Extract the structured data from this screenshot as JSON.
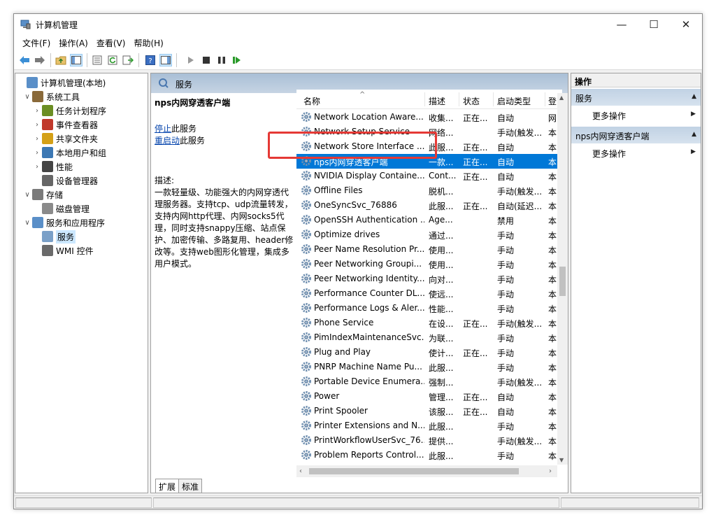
{
  "window": {
    "title": "计算机管理",
    "controls": {
      "minimize": "—",
      "maximize": "☐",
      "close": "✕"
    }
  },
  "menubar": [
    {
      "label": "文件(F)"
    },
    {
      "label": "操作(A)"
    },
    {
      "label": "查看(V)"
    },
    {
      "label": "帮助(H)"
    }
  ],
  "tree": [
    {
      "label": "计算机管理(本地)",
      "icon": "computer-management-icon",
      "level": 0,
      "expander": ""
    },
    {
      "label": "系统工具",
      "icon": "tools-icon",
      "level": 1,
      "expander": "∨"
    },
    {
      "label": "任务计划程序",
      "icon": "clock-icon",
      "level": 2,
      "expander": "›"
    },
    {
      "label": "事件查看器",
      "icon": "event-viewer-icon",
      "level": 2,
      "expander": "›"
    },
    {
      "label": "共享文件夹",
      "icon": "shared-folder-icon",
      "level": 2,
      "expander": "›"
    },
    {
      "label": "本地用户和组",
      "icon": "users-icon",
      "level": 2,
      "expander": "›"
    },
    {
      "label": "性能",
      "icon": "performance-icon",
      "level": 2,
      "expander": "›"
    },
    {
      "label": "设备管理器",
      "icon": "device-manager-icon",
      "level": 2,
      "expander": ""
    },
    {
      "label": "存储",
      "icon": "storage-icon",
      "level": 1,
      "expander": "∨"
    },
    {
      "label": "磁盘管理",
      "icon": "disk-management-icon",
      "level": 2,
      "expander": ""
    },
    {
      "label": "服务和应用程序",
      "icon": "services-apps-icon",
      "level": 1,
      "expander": "∨"
    },
    {
      "label": "服务",
      "icon": "services-icon",
      "level": 2,
      "expander": "",
      "selected": true
    },
    {
      "label": "WMI 控件",
      "icon": "wmi-icon",
      "level": 2,
      "expander": ""
    }
  ],
  "center": {
    "header": "服务",
    "service_title": "nps内网穿透客户端",
    "stop_link": "停止",
    "stop_suffix": "此服务",
    "restart_link": "重启动",
    "restart_suffix": "此服务",
    "desc_label": "描述:",
    "desc_text": "一款轻量级、功能强大的内网穿透代理服务器。支持tcp、udp流量转发，支持内网http代理、内网socks5代理，同时支持snappy压缩、站点保护、加密传输、多路复用、header修改等。支持web图形化管理，集成多用户模式。",
    "columns": {
      "name": "名称",
      "desc": "描述",
      "status": "状态",
      "startup": "启动类型",
      "login": "登"
    },
    "tabs": [
      {
        "label": "扩展",
        "active": true
      },
      {
        "label": "标准",
        "active": false
      }
    ]
  },
  "services": [
    {
      "name": "Network Location Aware...",
      "desc": "收集...",
      "status": "正在...",
      "startup": "自动",
      "login": "网"
    },
    {
      "name": "Network Setup Service",
      "desc": "网络...",
      "status": "",
      "startup": "手动(触发...",
      "login": "本"
    },
    {
      "name": "Network Store Interface ...",
      "desc": "此服...",
      "status": "正在...",
      "startup": "自动",
      "login": "本"
    },
    {
      "name": "nps内网穿透客户端",
      "desc": "一款...",
      "status": "正在...",
      "startup": "自动",
      "login": "本",
      "selected": true
    },
    {
      "name": "NVIDIA Display Containe...",
      "desc": "Cont...",
      "status": "正在...",
      "startup": "自动",
      "login": "本"
    },
    {
      "name": "Offline Files",
      "desc": "脱机...",
      "status": "",
      "startup": "手动(触发...",
      "login": "本"
    },
    {
      "name": "OneSyncSvc_76886",
      "desc": "此服...",
      "status": "正在...",
      "startup": "自动(延迟...",
      "login": "本"
    },
    {
      "name": "OpenSSH Authentication ...",
      "desc": "Age...",
      "status": "",
      "startup": "禁用",
      "login": "本"
    },
    {
      "name": "Optimize drives",
      "desc": "通过...",
      "status": "",
      "startup": "手动",
      "login": "本"
    },
    {
      "name": "Peer Name Resolution Pr...",
      "desc": "使用...",
      "status": "",
      "startup": "手动",
      "login": "本"
    },
    {
      "name": "Peer Networking Groupi...",
      "desc": "使用...",
      "status": "",
      "startup": "手动",
      "login": "本"
    },
    {
      "name": "Peer Networking Identity...",
      "desc": "向对...",
      "status": "",
      "startup": "手动",
      "login": "本"
    },
    {
      "name": "Performance Counter DL...",
      "desc": "使远...",
      "status": "",
      "startup": "手动",
      "login": "本"
    },
    {
      "name": "Performance Logs & Aler...",
      "desc": "性能...",
      "status": "",
      "startup": "手动",
      "login": "本"
    },
    {
      "name": "Phone Service",
      "desc": "在设...",
      "status": "正在...",
      "startup": "手动(触发...",
      "login": "本"
    },
    {
      "name": "PimIndexMaintenanceSvc...",
      "desc": "为联...",
      "status": "",
      "startup": "手动",
      "login": "本"
    },
    {
      "name": "Plug and Play",
      "desc": "使计...",
      "status": "正在...",
      "startup": "手动",
      "login": "本"
    },
    {
      "name": "PNRP Machine Name Pu...",
      "desc": "此服...",
      "status": "",
      "startup": "手动",
      "login": "本"
    },
    {
      "name": "Portable Device Enumera...",
      "desc": "强制...",
      "status": "",
      "startup": "手动(触发...",
      "login": "本"
    },
    {
      "name": "Power",
      "desc": "管理...",
      "status": "正在...",
      "startup": "自动",
      "login": "本"
    },
    {
      "name": "Print Spooler",
      "desc": "该服...",
      "status": "正在...",
      "startup": "自动",
      "login": "本"
    },
    {
      "name": "Printer Extensions and N...",
      "desc": "此服...",
      "status": "",
      "startup": "手动",
      "login": "本"
    },
    {
      "name": "PrintWorkflowUserSvc_76...",
      "desc": "提供...",
      "status": "",
      "startup": "手动(触发...",
      "login": "本"
    },
    {
      "name": "Problem Reports Control...",
      "desc": "此服...",
      "status": "",
      "startup": "手动",
      "login": "本"
    }
  ],
  "actions": {
    "title": "操作",
    "sections": [
      {
        "label": "服务",
        "item": "更多操作"
      },
      {
        "label": "nps内网穿透客户端",
        "item": "更多操作"
      }
    ]
  }
}
